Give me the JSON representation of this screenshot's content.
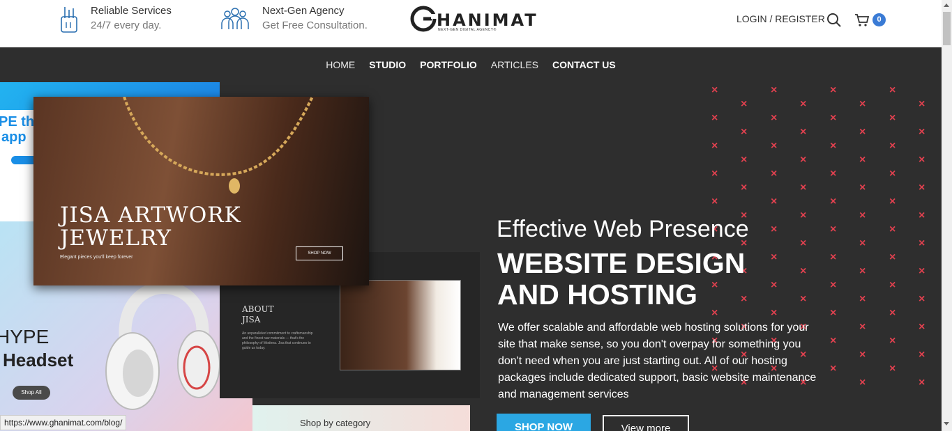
{
  "header": {
    "features": [
      {
        "title": "Reliable Services",
        "subtitle": "24/7 every day.",
        "icon": "hand-gesture-icon"
      },
      {
        "title": "Next-Gen Agency",
        "subtitle": "Get Free Consultation.",
        "icon": "team-icon"
      }
    ],
    "logo": {
      "text": "HANIMAT",
      "tagline": "NEXT-GEN DIGITAL AGENCY®",
      "icon": "g-circle-logo-icon"
    },
    "login_label": "LOGIN / REGISTER",
    "cart_count": "0"
  },
  "nav": {
    "items": [
      "HOME",
      "STUDIO",
      "PORTFOLIO",
      "ARTICLES",
      "CONTACT US"
    ]
  },
  "hero": {
    "kicker": "Effective Web Presence",
    "title": "WEBSITE DESIGN AND HOSTING",
    "description": "We offer scalable and affordable web hosting solutions for your site that make sense, so you don't overpay for something you don't need when you are just starting out. All of our hosting packages include dedicated support, basic website maintenance and management services",
    "primary_button": "SHOP NOW",
    "secondary_button": "View more",
    "accent_color": "#e0414f",
    "button_color": "#2ba7e3"
  },
  "collage": {
    "blue_card_line1": "PE th",
    "blue_card_line2": "app",
    "jewelry_title": "JISA ARTWORK JEWELRY",
    "jewelry_subtitle": "Elegant pieces you'll keep forever",
    "jewelry_button": "SHOP NOW",
    "about_title": "ABOUT JISA",
    "about_text": "An unparalleled commitment to craftsmanship and the finest raw materials — that's the philosophy of Modena. Jisa that continues to guide us today.",
    "headset_line1": "HYPE",
    "headset_line2": "Headset",
    "headset_button": "Shop All",
    "category_title": "Shop by category"
  },
  "status_url": "https://www.ghanimat.com/blog/"
}
